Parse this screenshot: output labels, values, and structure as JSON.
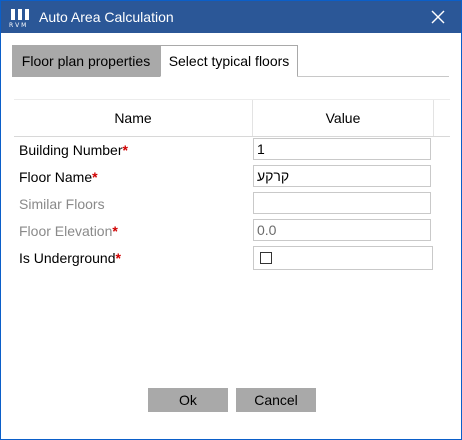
{
  "window": {
    "title": "Auto Area Calculation",
    "icon": "rvm-logo-icon",
    "title_bar_color": "#2b5797"
  },
  "tabs": [
    {
      "label": "Floor plan properties",
      "active": true
    },
    {
      "label": "Select typical floors",
      "active": false
    }
  ],
  "grid": {
    "headers": {
      "name": "Name",
      "value": "Value"
    },
    "rows": [
      {
        "label": "Building Number",
        "required": "*",
        "value": "1",
        "type": "text"
      },
      {
        "label": "Floor Name",
        "required": "*",
        "value": "קרקע",
        "type": "text"
      },
      {
        "label": "Similar Floors",
        "required": "",
        "value": "",
        "type": "text"
      },
      {
        "label": "Floor Elevation",
        "required": "*",
        "value": "0.0",
        "type": "text"
      },
      {
        "label": "Is Underground",
        "required": "*",
        "value": false,
        "type": "checkbox"
      }
    ]
  },
  "buttons": {
    "ok": "Ok",
    "cancel": "Cancel"
  },
  "colors": {
    "required_marker": "#d00000",
    "button_bg": "#a9a9a9",
    "active_tab_bg": "#a9a9a9"
  }
}
